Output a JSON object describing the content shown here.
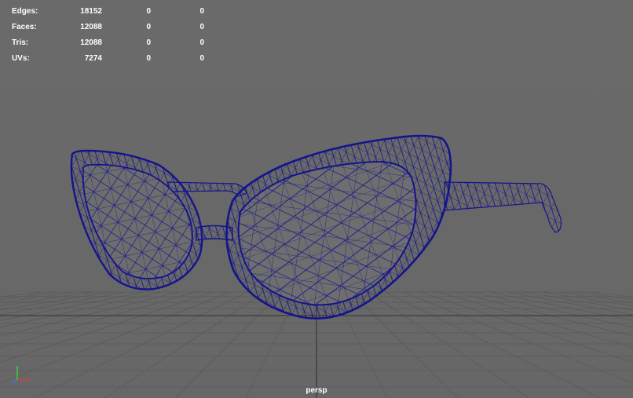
{
  "viewport": {
    "camera": "persp",
    "background_color": "#6b6b6b",
    "wire_color": "#14148c",
    "grid_color": "#5a5a5a",
    "grid_axis_color": "#3c3c3c"
  },
  "stats": [
    {
      "label": "Edges:",
      "total": "18152",
      "selected": "0",
      "component": "0"
    },
    {
      "label": "Faces:",
      "total": "12088",
      "selected": "0",
      "component": "0"
    },
    {
      "label": "Tris:",
      "total": "12088",
      "selected": "0",
      "component": "0"
    },
    {
      "label": "UVs:",
      "total": "7274",
      "selected": "0",
      "component": "0"
    }
  ],
  "axis_gizmo": {
    "x_color": "#e03c3c",
    "y_color": "#3cd23c",
    "z_color": "#4070ff",
    "icon": "axis-gizmo-icon"
  },
  "model": {
    "icon": "cat-eye-glasses-wireframe"
  }
}
